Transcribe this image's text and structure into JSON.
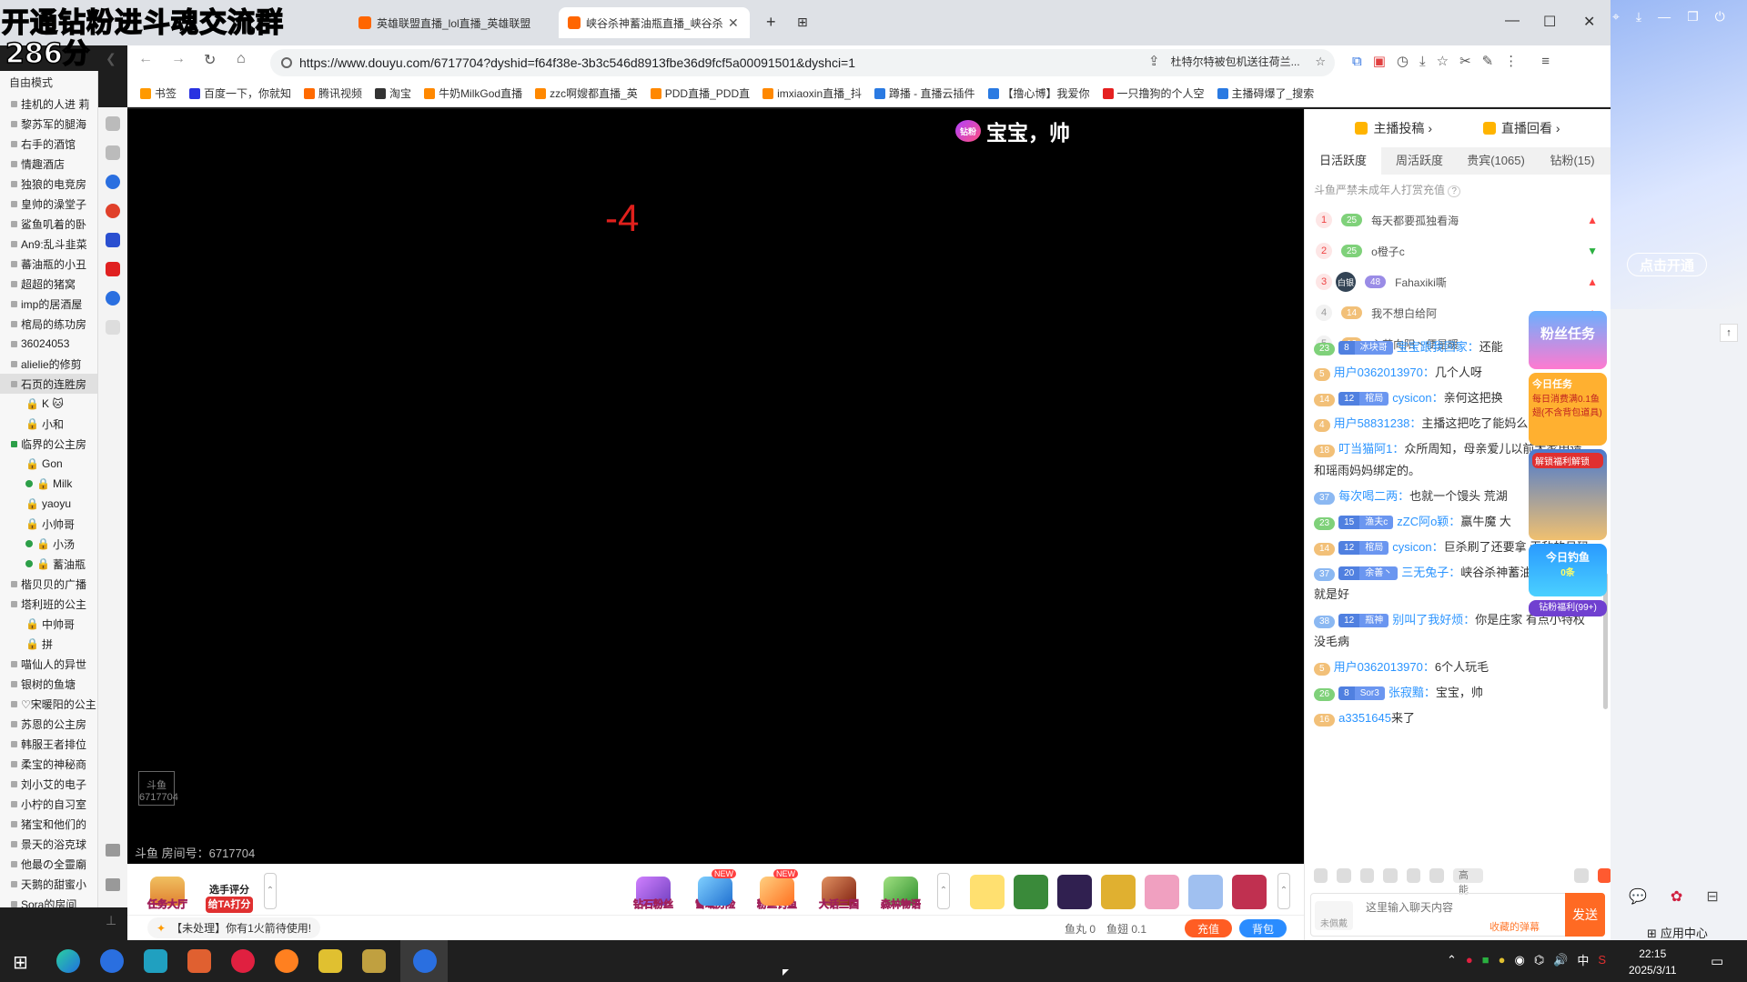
{
  "overlay": {
    "title": "开通钻粉进斗魂交流群",
    "score": "286分"
  },
  "browser": {
    "tabs": [
      {
        "label": "英雄联盟直播_lol直播_英雄联盟"
      },
      {
        "label": "峡谷杀神蓄油瓶直播_峡谷杀神"
      }
    ],
    "url": "https://www.douyu.com/6717704?dyshid=f64f38e-3b3c546d8913fbe36d9fcf5a00091501&dyshci=1",
    "promo_text": "杜特尔特被包机送往荷兰..."
  },
  "bookmarks": [
    {
      "label": "书签",
      "color": "#ff9900"
    },
    {
      "label": "百度一下，你就知",
      "color": "#2932e1"
    },
    {
      "label": "腾讯视频",
      "color": "#ff6a00"
    },
    {
      "label": "淘宝",
      "color": "#333333"
    },
    {
      "label": "牛奶MilkGod直播",
      "color": "#ff8800"
    },
    {
      "label": "zzc啊嫂都直播_英",
      "color": "#ff8800"
    },
    {
      "label": "PDD直播_PDD直",
      "color": "#ff8800"
    },
    {
      "label": "imxiaoxin直播_抖",
      "color": "#ff8800"
    },
    {
      "label": "蹲播 - 直播云插件",
      "color": "#2a7ae2"
    },
    {
      "label": "【撸心博】我爱你",
      "color": "#2a7ae2"
    },
    {
      "label": "一只撸狗的个人空",
      "color": "#e52020"
    },
    {
      "label": "主播碍爆了_搜索",
      "color": "#2a7ae2"
    }
  ],
  "left_list": {
    "header": "自由模式",
    "items": [
      {
        "label": "挂机的人进 莉",
        "kind": "room"
      },
      {
        "label": "黎苏军的腿海",
        "kind": "room"
      },
      {
        "label": "右手的酒馆",
        "kind": "room"
      },
      {
        "label": "情趣酒店",
        "kind": "room"
      },
      {
        "label": "独狼的电竞房",
        "kind": "room"
      },
      {
        "label": "皇帅的澡堂子",
        "kind": "room"
      },
      {
        "label": "鲨鱼叽着的卧",
        "kind": "room"
      },
      {
        "label": "An9:乱斗韭菜",
        "kind": "room"
      },
      {
        "label": "蕃油瓶的小丑",
        "kind": "room"
      },
      {
        "label": "超超的猪窝",
        "kind": "room"
      },
      {
        "label": "imp的居酒屋",
        "kind": "room"
      },
      {
        "label": "棺局的练功房",
        "kind": "room"
      },
      {
        "label": "36024053",
        "kind": "room"
      },
      {
        "label": "alielie的修剪",
        "kind": "room"
      },
      {
        "label": "石页的连胜房",
        "kind": "room",
        "selected": true
      },
      {
        "label": "K 🐱",
        "kind": "user"
      },
      {
        "label": "小和",
        "kind": "user"
      },
      {
        "label": "临界的公主房",
        "kind": "room-green"
      },
      {
        "label": "Gon",
        "kind": "user"
      },
      {
        "label": "Milk",
        "kind": "user-green"
      },
      {
        "label": "yaoyu",
        "kind": "user"
      },
      {
        "label": "小帅哥",
        "kind": "user"
      },
      {
        "label": "小汤",
        "kind": "user-green"
      },
      {
        "label": "蓄油瓶",
        "kind": "user-green"
      },
      {
        "label": "楷贝贝的广播",
        "kind": "room"
      },
      {
        "label": "塔利班的公主",
        "kind": "room"
      },
      {
        "label": "中帅哥",
        "kind": "user"
      },
      {
        "label": "拼",
        "kind": "user"
      },
      {
        "label": "喵仙人的异世",
        "kind": "room"
      },
      {
        "label": "银树的鱼塘",
        "kind": "room"
      },
      {
        "label": "♡宋暖阳的公主",
        "kind": "room"
      },
      {
        "label": "苏恩的公主房",
        "kind": "room"
      },
      {
        "label": "韩服王者排位",
        "kind": "room"
      },
      {
        "label": "柔宝的神秘商",
        "kind": "room"
      },
      {
        "label": "刘小艾的电子",
        "kind": "room"
      },
      {
        "label": "小柠的自习室",
        "kind": "room"
      },
      {
        "label": "猪宝和他们的",
        "kind": "room"
      },
      {
        "label": "景天的浴克球",
        "kind": "room"
      },
      {
        "label": "他最の全靈廟",
        "kind": "room"
      },
      {
        "label": "天鹅的甜蜜小",
        "kind": "room"
      },
      {
        "label": "Sora的房间",
        "kind": "room"
      }
    ]
  },
  "video": {
    "danmu_badge": "钻粉",
    "danmu_text": "宝宝，帅",
    "score_change": "-4",
    "room_label": "斗鱼 房间号：6717704",
    "watermark": "斗鱼 6717704"
  },
  "gifts_left": [
    {
      "label": "任务大厅"
    },
    {
      "label": "给TA打分",
      "top": "选手评分"
    }
  ],
  "gifts_mid": [
    {
      "label": "钻石粉丝",
      "color": "#c070ff"
    },
    {
      "label": "雪域历险",
      "color": "#3aa0ff",
      "new": "NEW"
    },
    {
      "label": "粉丝钓鱼",
      "color": "#ff9a3a",
      "new": "NEW"
    },
    {
      "label": "大话三国",
      "color": "#b05020"
    },
    {
      "label": "森林物语",
      "color": "#4ab04a"
    }
  ],
  "statusbar": {
    "notice": "【未处理】你有1火箭待使用!",
    "fish_ball": "鱼丸 0",
    "fish_fin": "鱼翅 0.1",
    "recharge": "充值",
    "backpack": "背包"
  },
  "right_panel": {
    "contribute": "主播投稿",
    "replay": "直播回看",
    "tabs": [
      "日活跃度",
      "周活跃度",
      "贵宾(1065)",
      "钻粉(15)"
    ],
    "warning": "斗鱼严禁未成年人打赏充值",
    "ranking": [
      {
        "rank": "1",
        "level": "25",
        "name": "每天都要孤独看海",
        "trend": "up"
      },
      {
        "rank": "2",
        "level": "25",
        "name": "o橙子c",
        "trend": "down"
      },
      {
        "rank": "3",
        "level": "48",
        "name": "Fahaxiki嘶",
        "trend": "up",
        "badge": "白银"
      },
      {
        "rank": "4",
        "level": "14",
        "name": "我不想白给阿",
        "trend": "up"
      },
      {
        "rank": "5",
        "level": "12",
        "name": "心若向阳丶便是暖",
        "trend": ""
      }
    ],
    "chat": [
      {
        "level": "23",
        "fan": "冰块哥",
        "fan_level": "8",
        "nick": "宝宝跟我回家：",
        "text": "还能"
      },
      {
        "level": "5",
        "nick": "用户0362013970：",
        "text": "几个人呀"
      },
      {
        "level": "14",
        "fan": "棺局",
        "fan_level": "12",
        "nick": "cysicon：",
        "text": "亲何这把换"
      },
      {
        "level": "4",
        "nick": "用户58831238：",
        "text": "主播这把吃了能妈么"
      },
      {
        "level": "18",
        "nick": "叮当猫阿1：",
        "text": "众所周知，母亲爱儿以前大家申请和瑶雨妈妈绑定的。"
      },
      {
        "level": "37",
        "nick": "每次喝二两：",
        "text": "也就一个馒头 荒湖"
      },
      {
        "level": "23",
        "fan": "渔夫c",
        "fan_level": "15",
        "nick": "zZC阿o颖：",
        "text": "赢牛魔 大"
      },
      {
        "level": "14",
        "fan": "棺局",
        "fan_level": "12",
        "nick": "cysicon：",
        "text": "巨杀刷了还要拿 无敌的号码"
      },
      {
        "level": "37",
        "fan": "余善丶",
        "fan_level": "20",
        "nick": "三无兔子：",
        "text": "峡谷杀神蓄油瓶：有码的就是好"
      },
      {
        "level": "38",
        "fan": "瓶神",
        "fan_level": "12",
        "nick": "别叫了我好烦：",
        "text": "你是庄家 有点小特权没毛病"
      },
      {
        "level": "5",
        "nick": "用户0362013970：",
        "text": "6个人玩毛"
      },
      {
        "level": "26",
        "fan": "Sor3",
        "fan_level": "8",
        "nick": "张寂黯：",
        "text": "宝宝，帅"
      },
      {
        "level": "16",
        "nick": "a3351645",
        "text": "来了"
      }
    ],
    "tools": {
      "gaoneng": "高能"
    },
    "input": {
      "wear": "未佩戴",
      "placeholder": "这里输入聊天内容",
      "collect": "收藏的弹幕",
      "send": "发送"
    }
  },
  "promo_col": {
    "task": "粉丝任务",
    "today": "今日任务",
    "daily": "每日消费满0.1鱼翅(不含背包道具)",
    "fish": "今日钓鱼",
    "fish_count": "0条",
    "welfare": "钻粉福利(99+)",
    "unlock": "解锁福利解锁"
  },
  "desk": {
    "kaiqi": "点击开通",
    "app_center": "应用中心"
  },
  "taskbar": {
    "time": "22:15",
    "date": "2025/3/11",
    "ime": "中"
  }
}
